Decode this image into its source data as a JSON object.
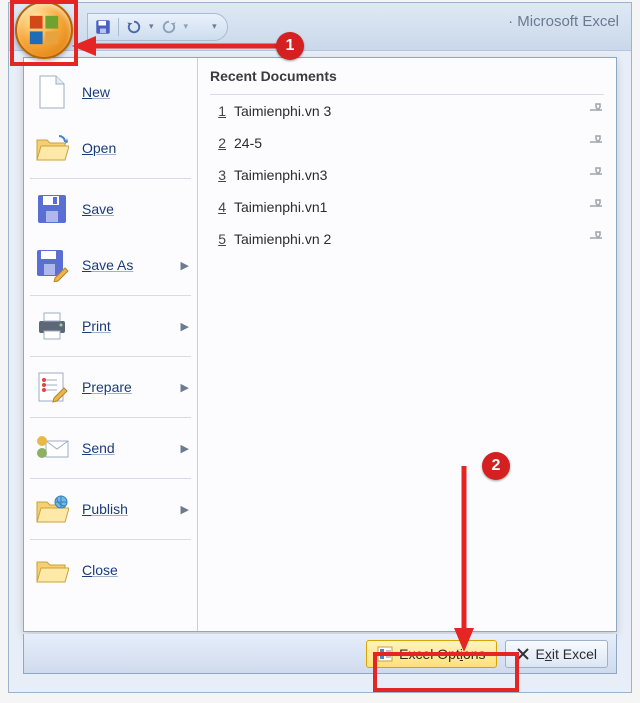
{
  "title": "· Microsoft Excel",
  "office_button": "office-button",
  "qat": {
    "save": "save-icon",
    "undo": "undo-icon",
    "redo": "redo-icon"
  },
  "menu": [
    {
      "label": "New",
      "icon": "new",
      "arrow": false
    },
    {
      "label": "Open",
      "icon": "open",
      "arrow": false
    },
    {
      "label": "Save",
      "icon": "save",
      "arrow": false
    },
    {
      "label": "Save As",
      "icon": "saveas",
      "arrow": true
    },
    {
      "label": "Print",
      "icon": "print",
      "arrow": true
    },
    {
      "label": "Prepare",
      "icon": "prepare",
      "arrow": true
    },
    {
      "label": "Send",
      "icon": "send",
      "arrow": true
    },
    {
      "label": "Publish",
      "icon": "publish",
      "arrow": true
    },
    {
      "label": "Close",
      "icon": "close",
      "arrow": false
    }
  ],
  "recent": {
    "title": "Recent Documents",
    "items": [
      {
        "n": "1",
        "name": "Taimienphi.vn 3"
      },
      {
        "n": "2",
        "name": "24-5"
      },
      {
        "n": "3",
        "name": "Taimienphi.vn3"
      },
      {
        "n": "4",
        "name": "Taimienphi.vn1"
      },
      {
        "n": "5",
        "name": "Taimienphi.vn 2"
      }
    ]
  },
  "buttons": {
    "options_prefix": "Excel Opt",
    "options_u": "i",
    "options_suffix": "ons",
    "exit_prefix": "E",
    "exit_u": "x",
    "exit_suffix": "it Excel"
  },
  "annotations": {
    "badge1": "1",
    "badge2": "2"
  }
}
